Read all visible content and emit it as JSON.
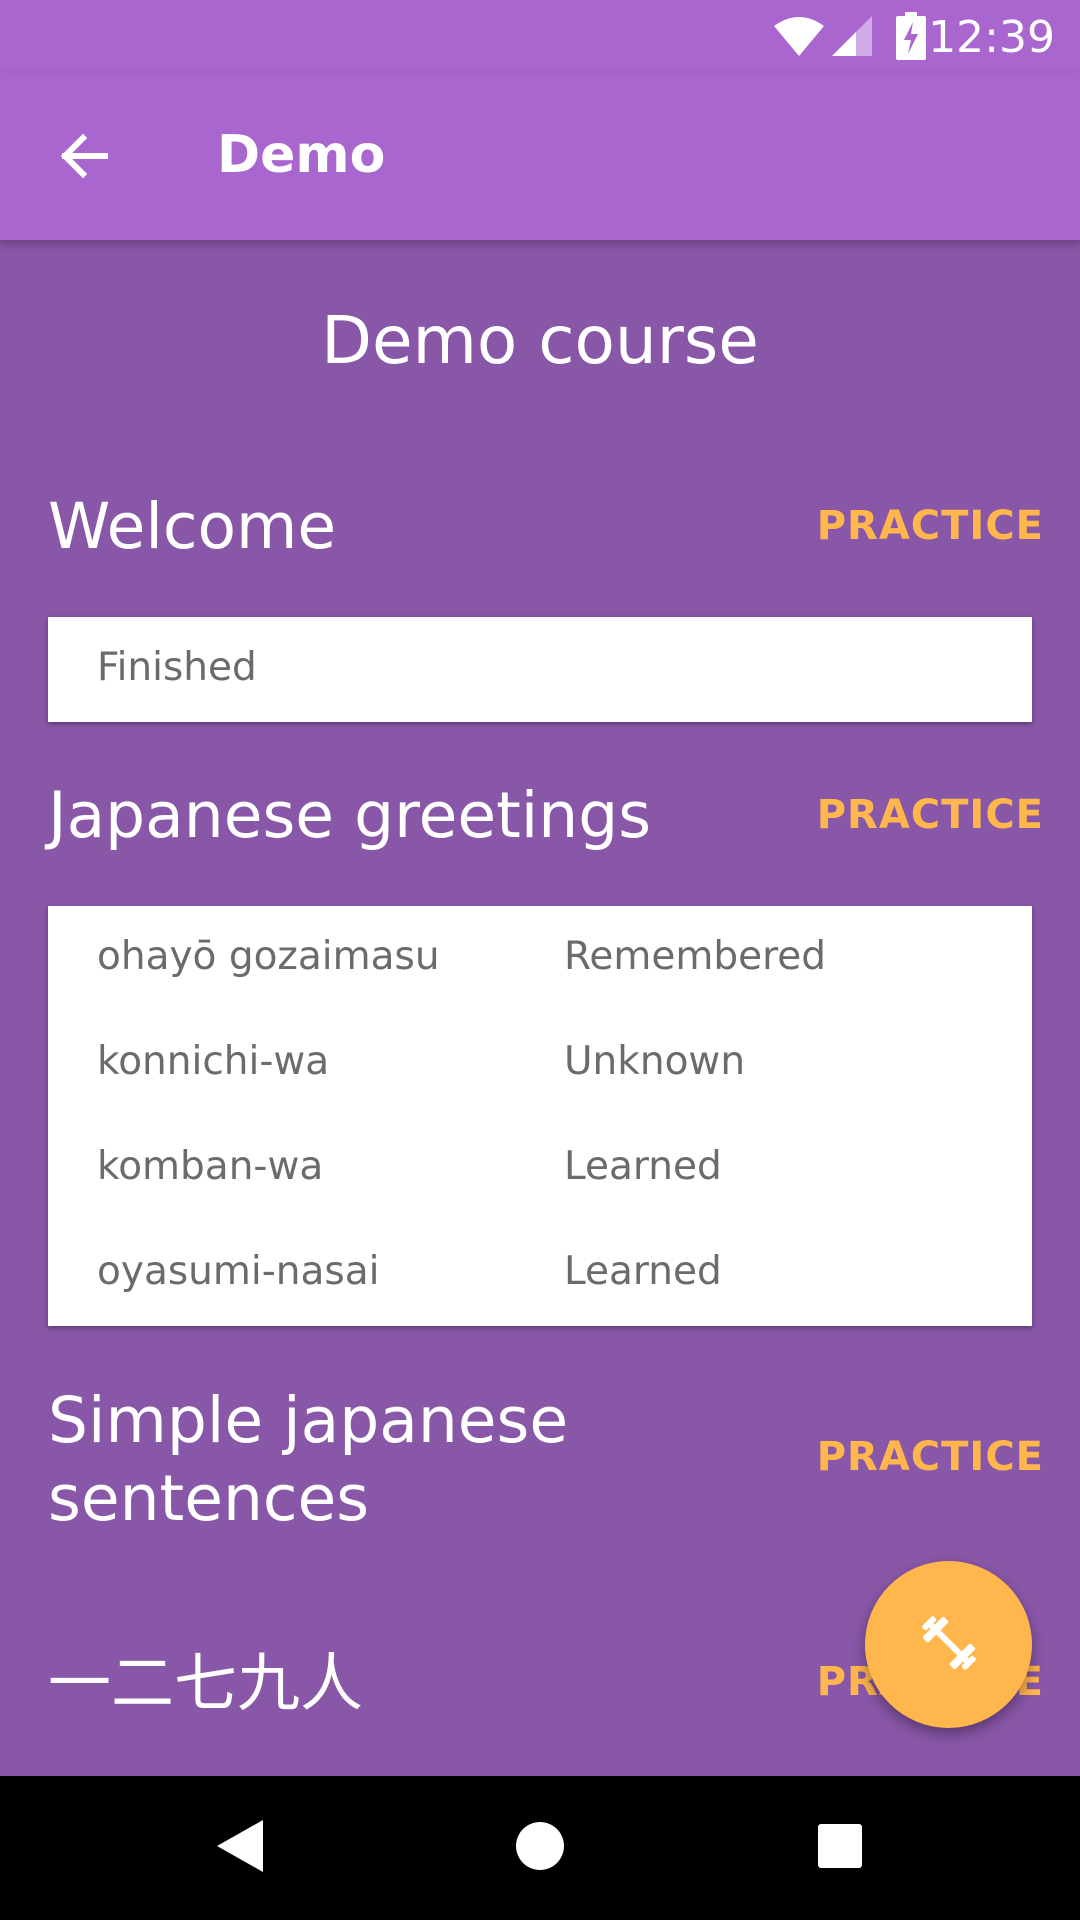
{
  "status_bar": {
    "time": "12:39",
    "icons": [
      "wifi-icon",
      "cell-signal-icon",
      "battery-charging-icon"
    ]
  },
  "app_bar": {
    "title": "Demo",
    "back_icon": "arrow-back-icon"
  },
  "course": {
    "title": "Demo course"
  },
  "lessons": [
    {
      "title": "Welcome",
      "practice_label": "PRACTICE",
      "items": [
        {
          "word": "Finished",
          "status": ""
        }
      ]
    },
    {
      "title": "Japanese greetings",
      "practice_label": "PRACTICE",
      "items": [
        {
          "word": "ohayō gozaimasu",
          "status": "Remembered"
        },
        {
          "word": "konnichi-wa",
          "status": "Unknown"
        },
        {
          "word": "komban-wa",
          "status": "Learned"
        },
        {
          "word": "oyasumi-nasai",
          "status": "Learned"
        }
      ]
    },
    {
      "title": "Simple japanese sentences",
      "practice_label": "PRACTICE"
    },
    {
      "title": "一二七九人",
      "practice_label": "PRACTICE"
    }
  ],
  "fab": {
    "icon": "dumbbell-icon"
  },
  "nav_bar": {
    "icons": [
      "nav-back-icon",
      "nav-home-icon",
      "nav-recents-icon"
    ]
  },
  "colors": {
    "app_bar": "#aa66cf",
    "background": "#8957a8",
    "accent": "#ffb74d",
    "card": "#ffffff",
    "card_text": "#6b6b6b"
  }
}
